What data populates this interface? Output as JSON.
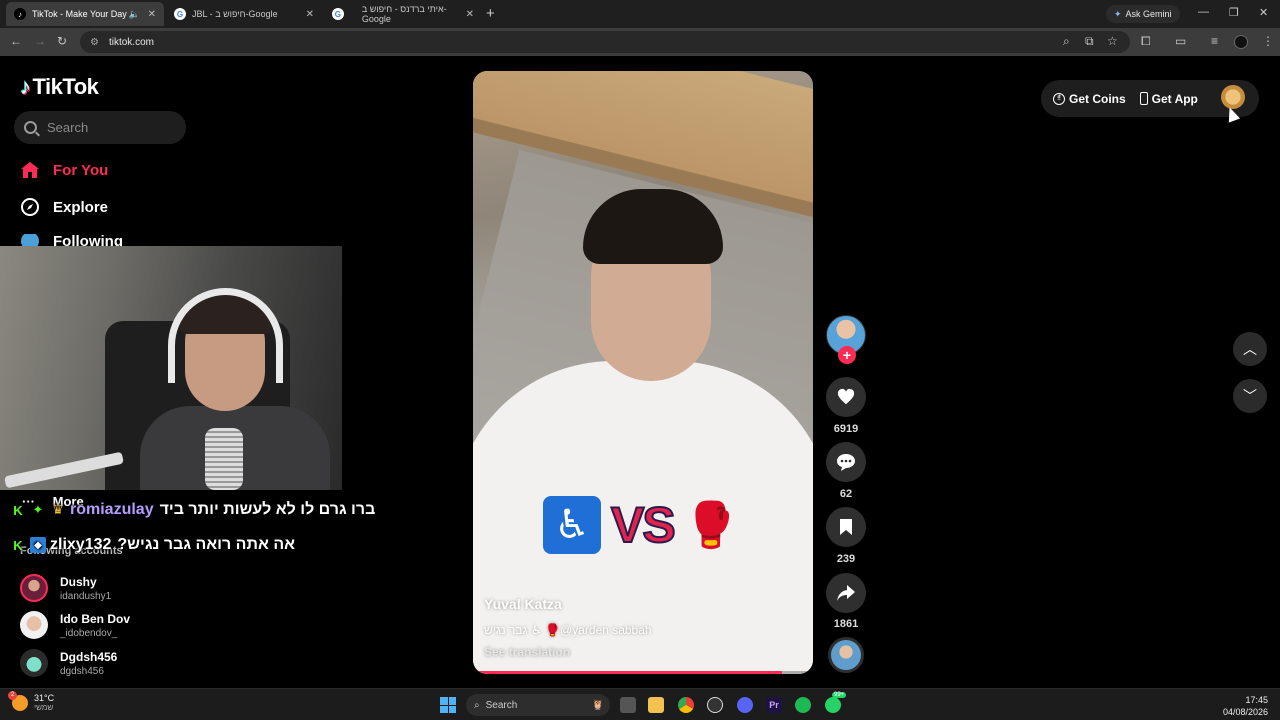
{
  "browser": {
    "tabs": [
      {
        "title": "TikTok - Make Your Day",
        "active": true
      },
      {
        "title": "JBL - חיפוש ב-Google",
        "active": false
      },
      {
        "title": "איתי ברדנס - חיפוש ב-Google",
        "active": false
      }
    ],
    "new_tab": "+",
    "ask_gemini": "Ask Gemini",
    "url": "tiktok.com",
    "window_controls": {
      "minimize": "—",
      "restore": "❐",
      "close": "✕"
    }
  },
  "sidebar": {
    "logo": "TikTok",
    "search_placeholder": "Search",
    "nav": [
      {
        "label": "For You",
        "icon": "home-icon"
      },
      {
        "label": "Explore",
        "icon": "compass-icon"
      },
      {
        "label": "Following",
        "icon": "following-icon"
      }
    ],
    "more_label": "More",
    "following_title": "Following accounts",
    "accounts": [
      {
        "name": "Dushy",
        "handle": "idandushy1"
      },
      {
        "name": "Ido Ben Dov",
        "handle": "_idobendov_"
      },
      {
        "name": "Dgdsh456",
        "handle": "dgdsh456"
      }
    ]
  },
  "chat": [
    {
      "user": "romiazulay",
      "message": "ברו גרם לו לא לעשות יותר ביד"
    },
    {
      "user": "zlixy132",
      "message": "אה אתה רואה גבר נגיש?"
    }
  ],
  "video": {
    "overlay_vs": "VS",
    "author": "Yuval Katza",
    "caption": "גבר נגיש ♿ 🥊@yarden sabbah",
    "see_translation": "See translation",
    "progress": 0.91
  },
  "actions": {
    "likes": "6919",
    "comments": "62",
    "saves": "239",
    "shares": "1861",
    "follow_plus": "+"
  },
  "header": {
    "get_coins": "Get Coins",
    "get_app": "Get App"
  },
  "taskbar": {
    "weather_temp": "31°C",
    "weather_desc": "שמשי",
    "weather_badge": "2",
    "search_label": "Search",
    "time": "17:45",
    "date": "04/08/2026",
    "badge_count": "99+"
  },
  "colors": {
    "accent": "#fe2c55",
    "background": "#000000",
    "panel": "#1e1e1e"
  }
}
